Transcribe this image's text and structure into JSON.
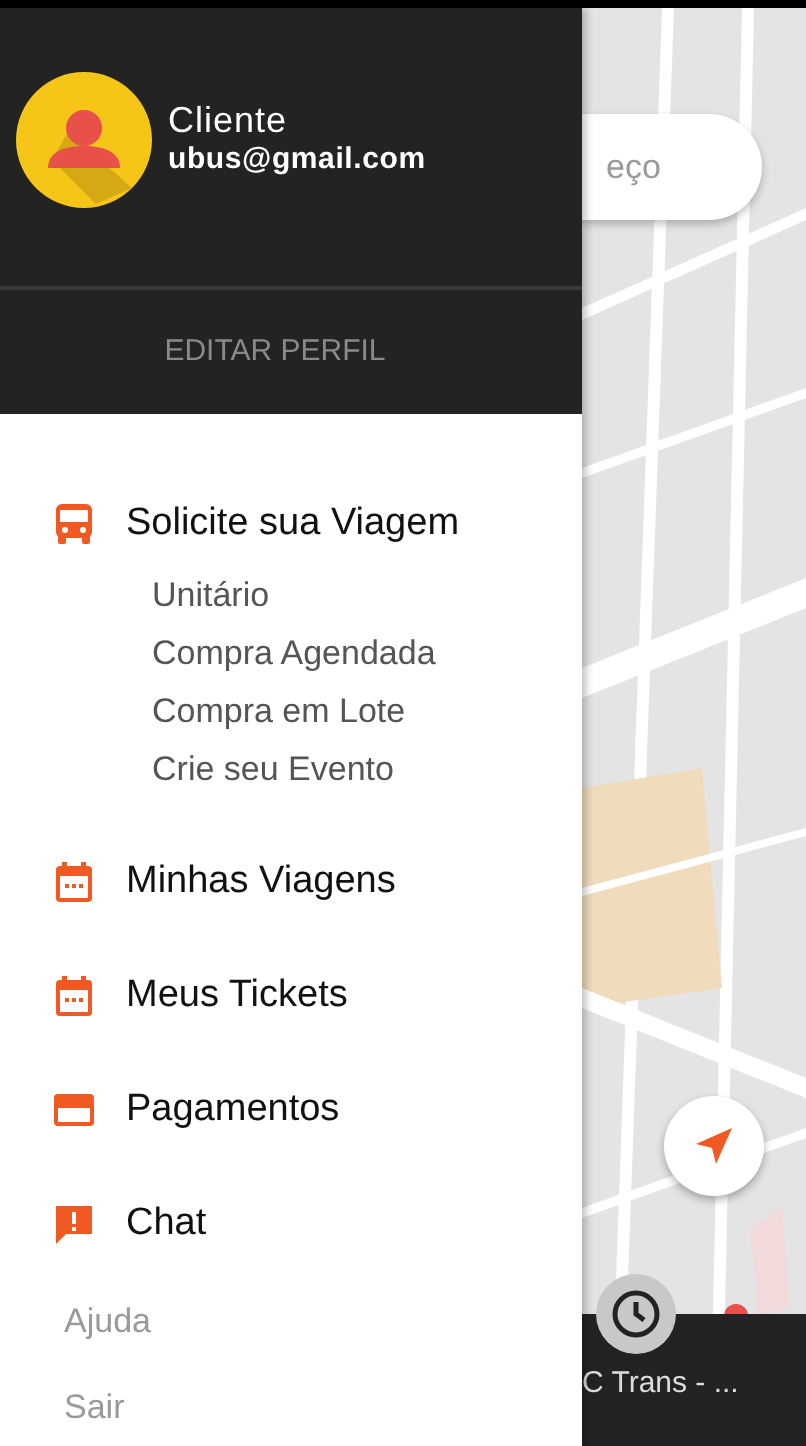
{
  "drawer": {
    "profile": {
      "name": "Cliente",
      "email": "ubus@gmail.com"
    },
    "edit_profile": "EDITAR PERFIL",
    "menu": [
      {
        "kind": "primary",
        "label": "Solicite sua Viagem",
        "children": [
          {
            "label": "Unitário"
          },
          {
            "label": "Compra Agendada"
          },
          {
            "label": "Compra em Lote"
          },
          {
            "label": "Crie seu Evento"
          }
        ]
      },
      {
        "kind": "primary",
        "label": "Minhas Viagens"
      },
      {
        "kind": "primary",
        "label": "Meus Tickets"
      },
      {
        "kind": "primary",
        "label": "Pagamentos"
      },
      {
        "kind": "primary",
        "label": "Chat"
      },
      {
        "kind": "secondary",
        "label": "Ajuda"
      },
      {
        "kind": "secondary",
        "label": "Sair"
      }
    ]
  },
  "map": {
    "search": {
      "placeholder": "eço"
    },
    "bottom_bar": {
      "text": "C Trans - ..."
    }
  }
}
